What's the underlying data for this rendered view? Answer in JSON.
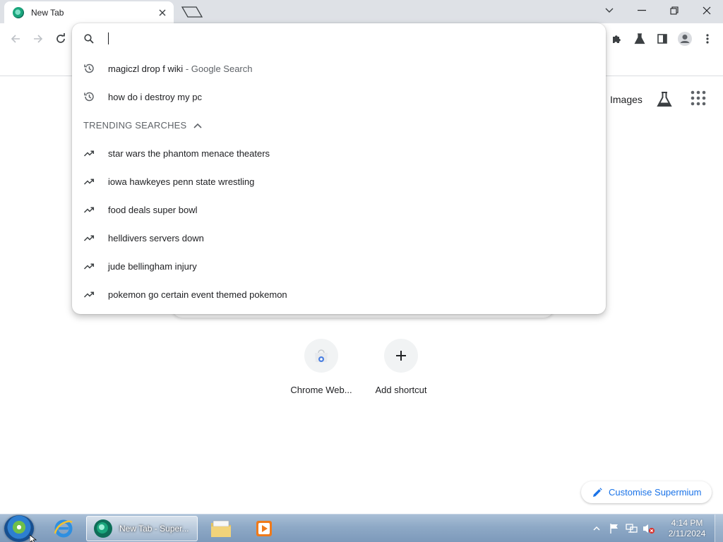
{
  "window": {
    "tab_title": "New Tab"
  },
  "omnibox": {
    "input_value": "",
    "history": [
      {
        "query": "magiczl drop f wiki",
        "suffix": " - Google Search"
      },
      {
        "query": "how do i destroy my pc",
        "suffix": ""
      }
    ],
    "trending_header": "TRENDING SEARCHES",
    "trending": [
      "star wars the phantom menace theaters",
      "iowa hawkeyes penn state wrestling",
      "food deals super bowl",
      "helldivers servers down",
      "jude bellingham injury",
      "pokemon go certain event themed pokemon"
    ]
  },
  "page": {
    "images_link": "Images",
    "shortcuts": [
      {
        "label": "Chrome Web..."
      },
      {
        "label": "Add shortcut"
      }
    ],
    "customise_label": "Customise Supermium"
  },
  "taskbar": {
    "active_task_label": "New Tab - Super...",
    "clock_time": "4:14 PM",
    "clock_date": "2/11/2024"
  },
  "colors": {
    "accent": "#1a73e8",
    "tabstrip": "#dee1e6",
    "taskbar": "#8ea9c6"
  }
}
